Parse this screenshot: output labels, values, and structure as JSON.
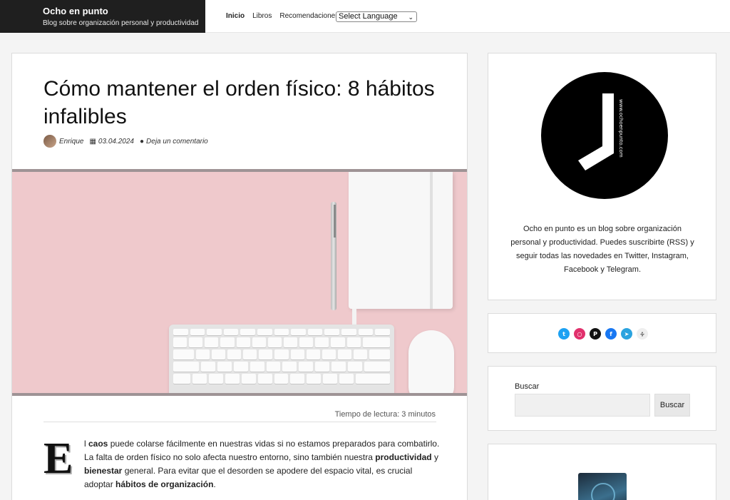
{
  "site": {
    "title": "Ocho en punto",
    "tagline": "Blog sobre organización personal y productividad"
  },
  "nav": {
    "items": [
      "Inicio",
      "Libros",
      "Recomendaciones"
    ],
    "active": "Inicio",
    "language_select": "Select Language"
  },
  "post": {
    "title": "Cómo mantener el orden físico: 8 hábitos infalibles",
    "author": "Enrique",
    "date": "03.04.2024",
    "comment_link": "Deja un comentario",
    "reading_time": "Tiempo de lectura: 3 minutos",
    "dropcap": "E",
    "intro": {
      "p1": "l ",
      "b1": "caos",
      "p2": " puede colarse fácilmente en nuestras vidas si no estamos preparados para combatirlo. La falta de orden físico no solo afecta nuestro entorno, sino también nuestra ",
      "b2": "productividad",
      "p3": " y ",
      "b3": "bienestar",
      "p4": " general. Para evitar que el desorden se apodere del espacio vital, es crucial adoptar ",
      "b4": "hábitos de organización",
      "p5": "."
    }
  },
  "sidebar": {
    "about_text": "Ocho en punto es un blog sobre organización personal y productividad. Puedes suscribirte (RSS) y seguir todas las novedades en Twitter, Instagram, Facebook y Telegram.",
    "logo_url_text": "www.ochoenpunto.com",
    "social_icons": [
      "twitter-icon",
      "instagram-icon",
      "pocket-icon",
      "facebook-icon",
      "telegram-icon",
      "rss-icon"
    ],
    "search_label": "Buscar",
    "search_button": "Buscar"
  },
  "colors": {
    "brand_bar": "#1f1f1f",
    "hero_bg": "#efc9cc",
    "twitter": "#1da1f2",
    "instagram": "#e1306c",
    "facebook": "#1877f2",
    "telegram": "#2aa3df"
  }
}
